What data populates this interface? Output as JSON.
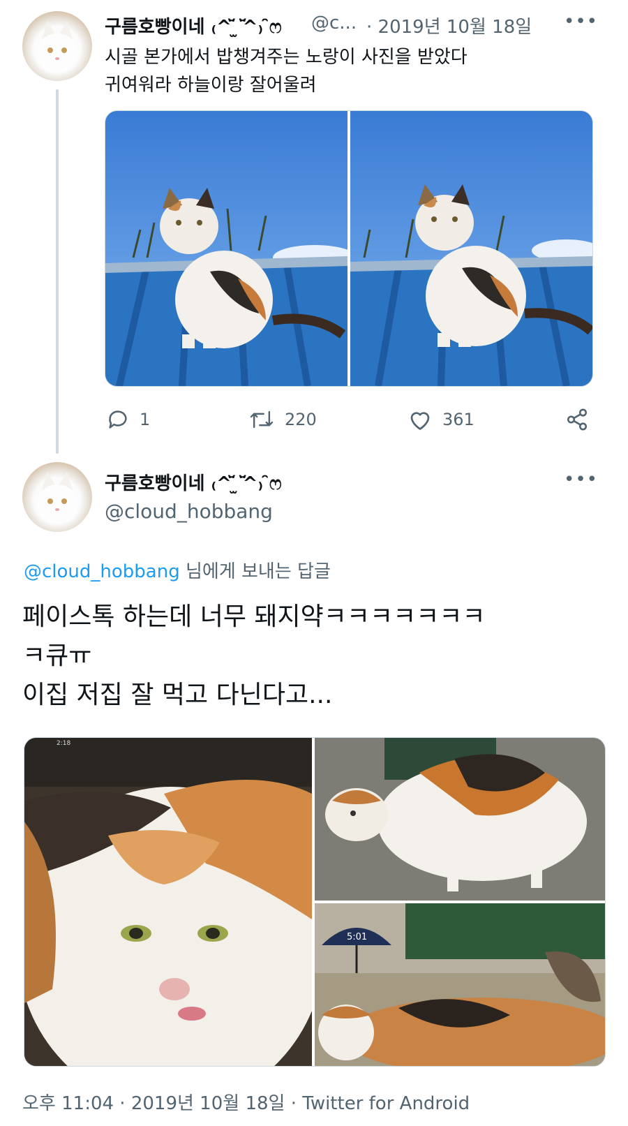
{
  "tweet1": {
    "display_name": "구름호빵이네 ₍^꙼̈ ̫ ꙼̈^₎ ̑̑ෆ",
    "handle": "@c...",
    "date": "· 2019년 10월 18일",
    "text_line1": "시골 본가에서 밥챙겨주는 노랑이 사진을 받았다",
    "text_line2": "귀여워라 하늘이랑 잘어울려",
    "replies": "1",
    "retweets": "220",
    "likes": "361"
  },
  "tweet2": {
    "display_name": "구름호빵이네 ₍^꙼̈ ̫ ꙼̈^₎ ̑̑ෆ",
    "handle": "@cloud_hobbang",
    "reply_to_handle": "@cloud_hobbang",
    "reply_to_suffix": " 님에게 보내는 답글",
    "text_line1": "페이스톡 하는데 너무 돼지약ㅋㅋㅋㅋㅋㅋㅋ",
    "text_line2": "ㅋ큐ㅠ",
    "text_line3": "이집 저집 잘 먹고 다닌다고...",
    "video_time_small": "2:18",
    "video_time": "5:01",
    "timestamp": "오후 11:04 · 2019년 10월 18일 · Twitter for Android"
  },
  "colors": {
    "text": "#0f1419",
    "secondary": "#536471",
    "accent": "#1d9bf0",
    "thread": "#cfd9de"
  },
  "icons": {
    "more": "more-horizontal-icon",
    "reply": "reply-icon",
    "retweet": "retweet-icon",
    "like": "heart-icon",
    "share": "share-icon"
  }
}
